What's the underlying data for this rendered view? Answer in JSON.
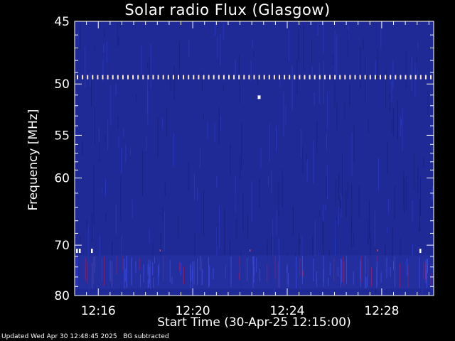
{
  "chart_data": {
    "type": "heatmap",
    "title": "Solar radio Flux (Glasgow)",
    "xlabel": "Start Time (30-Apr-25 12:15:00)",
    "ylabel": "Frequency [MHz]",
    "x_ticks": [
      "12:16",
      "12:20",
      "12:24",
      "12:28"
    ],
    "x_tick_minutes": [
      16,
      20,
      24,
      28
    ],
    "xlim_minutes": [
      15.0,
      30.2
    ],
    "y_ticks": [
      45,
      50,
      55,
      60,
      70,
      80
    ],
    "ylim": [
      45,
      80
    ],
    "y_scale": "reciprocal",
    "background_color": "#1f2a96",
    "interference_lines": [
      {
        "frequency": 49.4,
        "color": "#ffe9c0"
      },
      {
        "frequency": 71.0,
        "color": "#ffffff"
      }
    ],
    "features": [
      {
        "type": "band",
        "from": 71.8,
        "to": 78.5,
        "color": "#8a1f6a"
      }
    ]
  },
  "footer": {
    "updated": "Updated Wed Apr 30 12:48:45 2025",
    "note": "BG subtracted"
  }
}
